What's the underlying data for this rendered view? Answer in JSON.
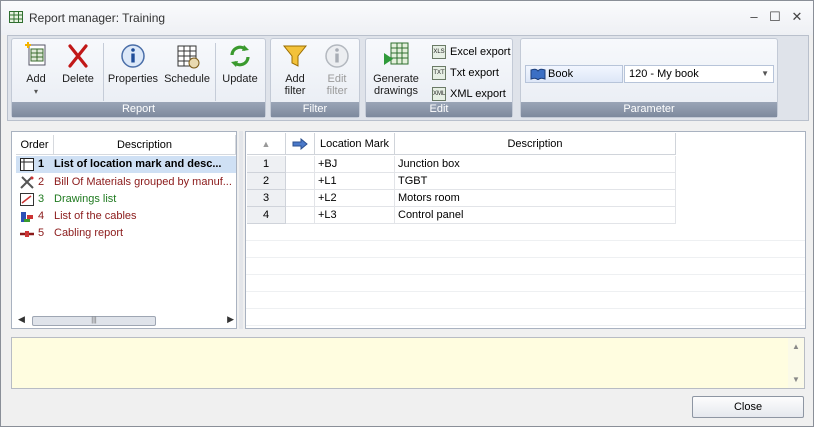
{
  "window": {
    "title": "Report manager: Training",
    "controls": {
      "minimize": "–",
      "maximize": "☐",
      "close": "✕"
    }
  },
  "ribbon": {
    "groups": {
      "report": "Report",
      "filter": "Filter",
      "edit": "Edit",
      "parameter": "Parameter"
    },
    "buttons": {
      "add": "Add",
      "add_arrow": "▾",
      "delete": "Delete",
      "properties": "Properties",
      "schedule": "Schedule",
      "update": "Update",
      "add_filter_1": "Add",
      "add_filter_2": "filter",
      "edit_filter_1": "Edit",
      "edit_filter_2": "filter",
      "generate_1": "Generate",
      "generate_2": "drawings",
      "excel_export": "Excel export",
      "txt_export": "Txt export",
      "xml_export": "XML export"
    },
    "parameter": {
      "label": "Book",
      "value": "120 - My book"
    }
  },
  "report_list": {
    "headers": {
      "order": "Order",
      "description": "Description"
    },
    "rows": [
      {
        "order": "1",
        "description": "List of location mark and desc...",
        "color": "#000000",
        "icon": "table-report-icon"
      },
      {
        "order": "2",
        "description": "Bill Of Materials grouped by manuf...",
        "color": "#8b1a1a",
        "icon": "tools-icon"
      },
      {
        "order": "3",
        "description": "Drawings list",
        "color": "#1f7a1f",
        "icon": "drawing-icon"
      },
      {
        "order": "4",
        "description": "List of the cables",
        "color": "#8b1a1a",
        "icon": "cables-icon"
      },
      {
        "order": "5",
        "description": "Cabling report",
        "color": "#8b1a1a",
        "icon": "cable-report-icon"
      }
    ],
    "scroll": {
      "left": "◀",
      "right": "▶",
      "thumb": "|||"
    }
  },
  "grid": {
    "headers": {
      "sort": "▲",
      "location_mark": "Location Mark",
      "description": "Description"
    },
    "rows": [
      {
        "n": "1",
        "mark": "+BJ",
        "desc": "Junction box"
      },
      {
        "n": "2",
        "mark": "+L1",
        "desc": "TGBT"
      },
      {
        "n": "3",
        "mark": "+L2",
        "desc": "Motors room"
      },
      {
        "n": "4",
        "mark": "+L3",
        "desc": "Control panel"
      }
    ]
  },
  "notes": {
    "scroll_up": "▲",
    "scroll_down": "▼"
  },
  "footer": {
    "close": "Close"
  }
}
